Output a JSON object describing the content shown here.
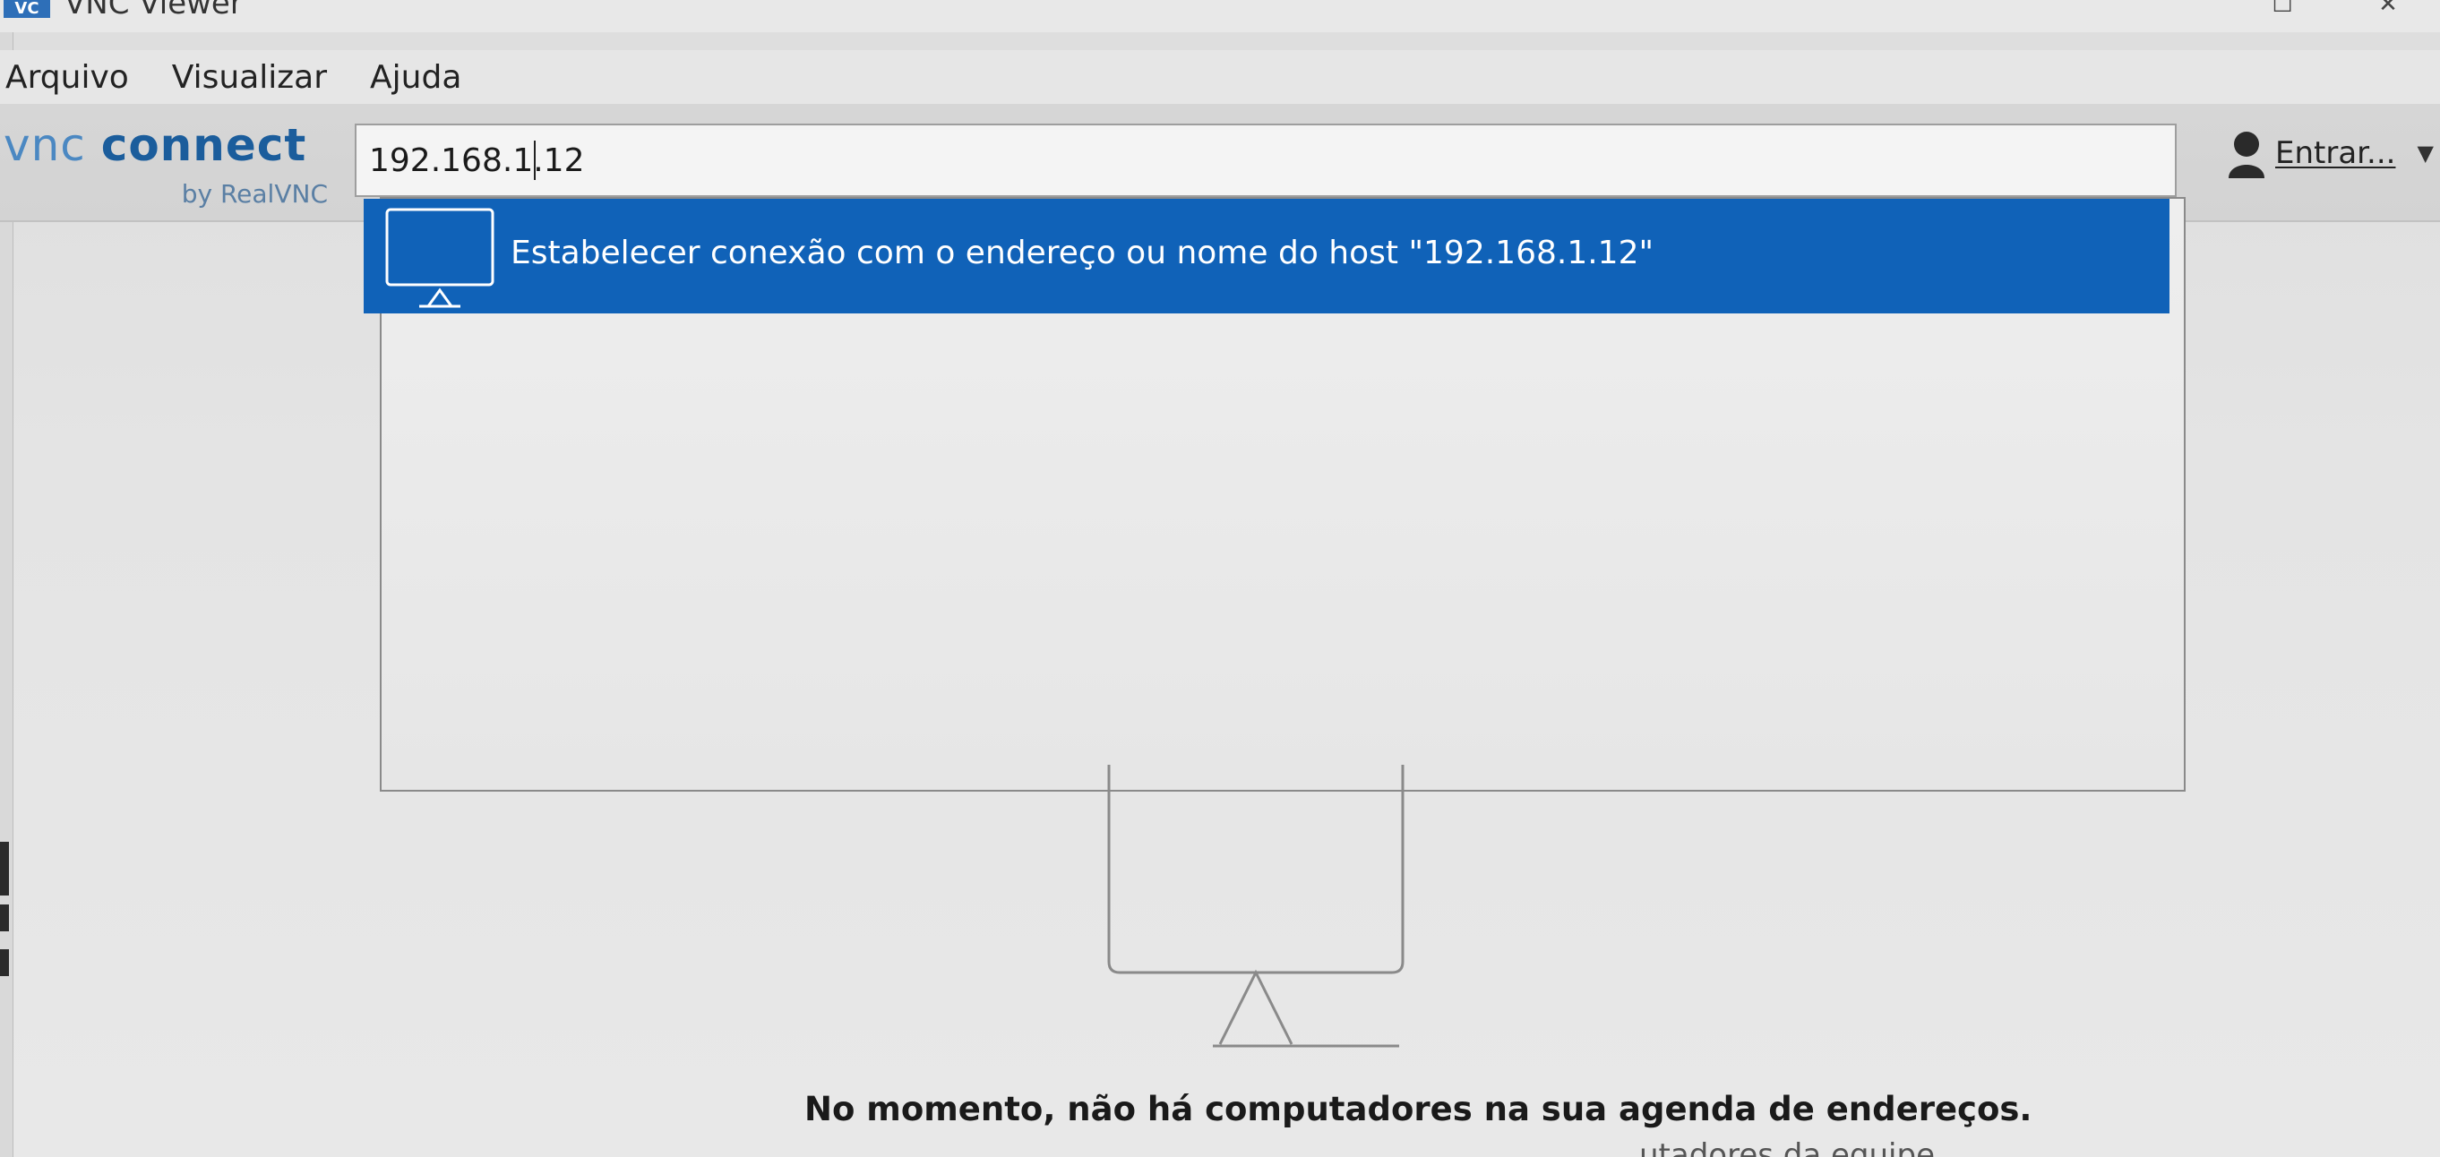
{
  "window": {
    "title": "VNC Viewer",
    "icon_label": "VC"
  },
  "menu": {
    "items": [
      "Arquivo",
      "Visualizar",
      "Ajuda"
    ]
  },
  "toolbar": {
    "logo_main_vnc": "vnc",
    "logo_main_connect": "connect",
    "logo_sub": "by RealVNC",
    "address_value": "192.168.1.12",
    "signin_label": "Entrar...",
    "signin_arrow": "▼"
  },
  "dropdown": {
    "suggestion_text": "Estabelecer conexão com o endereço ou nome do host \"192.168.1.12\""
  },
  "empty_state": {
    "message": "No momento, não há computadores na sua agenda de endereços.",
    "cut_off_text": "utadores da equipe"
  },
  "colors": {
    "accent": "#1062b8",
    "logo_blue": "#1b5d9c"
  },
  "icons": {
    "monitor": "monitor-icon",
    "user": "user-icon"
  }
}
